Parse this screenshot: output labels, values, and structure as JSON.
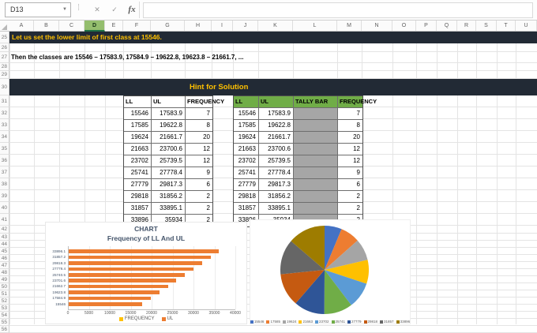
{
  "chrome": {
    "name_box_value": "D13",
    "cancel_icon": "✕",
    "enter_icon": "✓",
    "fx_icon": "fx",
    "formula_value": ""
  },
  "column_letters": [
    "A",
    "B",
    "C",
    "D",
    "E",
    "F",
    "G",
    "H",
    "I",
    "J",
    "K",
    "L",
    "M",
    "N",
    "O",
    "P",
    "Q",
    "R",
    "S",
    "T",
    "U"
  ],
  "selected_column": "D",
  "row_numbers": [
    25,
    26,
    27,
    28,
    29,
    30,
    31,
    32,
    33,
    34,
    35,
    36,
    37,
    38,
    39,
    40,
    41,
    42,
    43,
    44,
    45,
    46,
    47,
    48,
    49,
    50,
    51,
    52,
    53,
    54,
    55,
    56
  ],
  "notes": {
    "limit_note": "Let us set the lower limit of first class at 15546.",
    "classes_note": "Then the classes are 15546 – 17583.9, 17584.9 – 19622.8, 19623.8 – 21661.7, ...",
    "hint_banner": "Hint for Solution"
  },
  "frequency_table_left": {
    "headers": [
      "LL",
      "UL",
      "FREQUENCY"
    ],
    "rows": [
      [
        "15546",
        "17583.9",
        "7"
      ],
      [
        "17585",
        "19622.8",
        "8"
      ],
      [
        "19624",
        "21661.7",
        "20"
      ],
      [
        "21663",
        "23700.6",
        "12"
      ],
      [
        "23702",
        "25739.5",
        "12"
      ],
      [
        "25741",
        "27778.4",
        "9"
      ],
      [
        "27779",
        "29817.3",
        "6"
      ],
      [
        "29818",
        "31856.2",
        "2"
      ],
      [
        "31857",
        "33895.1",
        "2"
      ],
      [
        "33896",
        "35934",
        "2"
      ]
    ]
  },
  "frequency_table_right": {
    "headers": [
      "LL",
      "UL",
      "TALLY BAR",
      "FREQUENCY"
    ],
    "rows": [
      [
        "15546",
        "17583.9",
        "",
        "7"
      ],
      [
        "17585",
        "19622.8",
        "",
        "8"
      ],
      [
        "19624",
        "21661.7",
        "",
        "20"
      ],
      [
        "21663",
        "23700.6",
        "",
        "12"
      ],
      [
        "23702",
        "25739.5",
        "",
        "12"
      ],
      [
        "25741",
        "27778.4",
        "",
        "9"
      ],
      [
        "27779",
        "29817.3",
        "",
        "6"
      ],
      [
        "29818",
        "31856.2",
        "",
        "2"
      ],
      [
        "31857",
        "33895.1",
        "",
        "2"
      ],
      [
        "33896",
        "35934",
        "",
        "2"
      ]
    ]
  },
  "chart_data": [
    {
      "type": "bar",
      "orientation": "horizontal",
      "title": "CHART",
      "subtitle": "Frequency of LL And UL",
      "categories_top_to_bottom": [
        "33896.1",
        "31857.2",
        "29818.3",
        "27779.4",
        "25740.5",
        "23701.6",
        "21662.7",
        "19623.8",
        "17584.9",
        "15546"
      ],
      "series": [
        {
          "name": "FREQUENCY",
          "color": "#FFC000",
          "values_top_to_bottom": [
            2,
            2,
            2,
            6,
            9,
            12,
            12,
            20,
            8,
            7
          ]
        },
        {
          "name": "UL",
          "color": "#ED7D31",
          "values_top_to_bottom": [
            35934,
            33895.1,
            31856.2,
            29817.3,
            27778.4,
            25739.5,
            23700.6,
            21661.7,
            19622.8,
            17583.9
          ]
        }
      ],
      "value_axis": {
        "min": 0,
        "max": 40000,
        "tick_labels": [
          "0",
          "5000",
          "10000",
          "15000",
          "20000",
          "25000",
          "30000",
          "35000",
          "40000"
        ]
      },
      "gridlines": true,
      "legend_position": "bottom"
    },
    {
      "type": "pie",
      "labels": [
        "15546",
        "17585",
        "19624",
        "21663",
        "23702",
        "25741",
        "27779",
        "29818",
        "31857",
        "33896"
      ],
      "values": [
        15546,
        17585,
        19624,
        21663,
        23702,
        25741,
        27779,
        29818,
        31857,
        33896
      ],
      "colors": [
        "#4472C4",
        "#ED7D31",
        "#A5A5A5",
        "#FFC000",
        "#5B9BD5",
        "#70AD47",
        "#2F5597",
        "#C55A11",
        "#666666",
        "#9E7C00"
      ],
      "legend_position": "bottom"
    }
  ],
  "colors": {
    "banner_bg": "#222A35",
    "banner_text": "#FFC000",
    "header_green": "#70AD47",
    "tally_gray": "#A6A6A6",
    "bar_orange": "#ED7D31",
    "frequency_yellow": "#FFC000"
  }
}
